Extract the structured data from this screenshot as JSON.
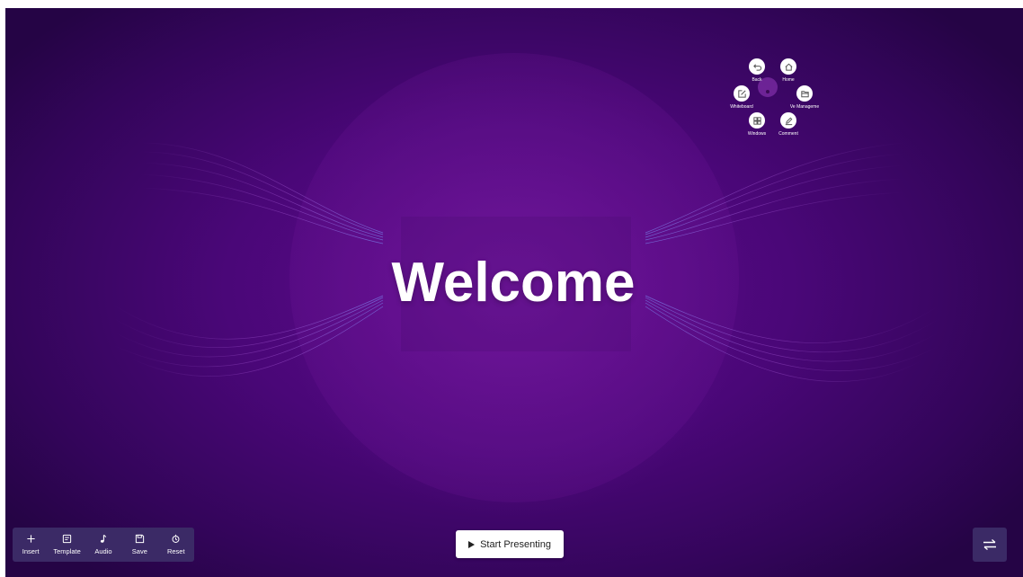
{
  "slide": {
    "title": "Welcome"
  },
  "quick_menu": {
    "items": [
      {
        "label": "Back",
        "icon": "undo-icon"
      },
      {
        "label": "Home",
        "icon": "home-icon"
      },
      {
        "label": "Whiteboard",
        "icon": "edit-square-icon"
      },
      {
        "label": "Ve Manageme",
        "icon": "folder-icon"
      },
      {
        "label": "Windows",
        "icon": "grid-icon"
      },
      {
        "label": "Comment",
        "icon": "pen-icon"
      }
    ]
  },
  "toolbar": {
    "items": [
      {
        "label": "Insert",
        "icon": "plus-icon"
      },
      {
        "label": "Template",
        "icon": "template-icon"
      },
      {
        "label": "Audio",
        "icon": "music-note-icon"
      },
      {
        "label": "Save",
        "icon": "save-icon"
      },
      {
        "label": "Reset",
        "icon": "reset-icon"
      }
    ]
  },
  "start_button": {
    "label": "Start Presenting",
    "icon": "play-icon"
  },
  "switch_button": {
    "icon": "swap-arrows-icon"
  },
  "colors": {
    "background": "#4a0778",
    "toolbar": "#3b2a66",
    "accent": "#ffffff"
  }
}
